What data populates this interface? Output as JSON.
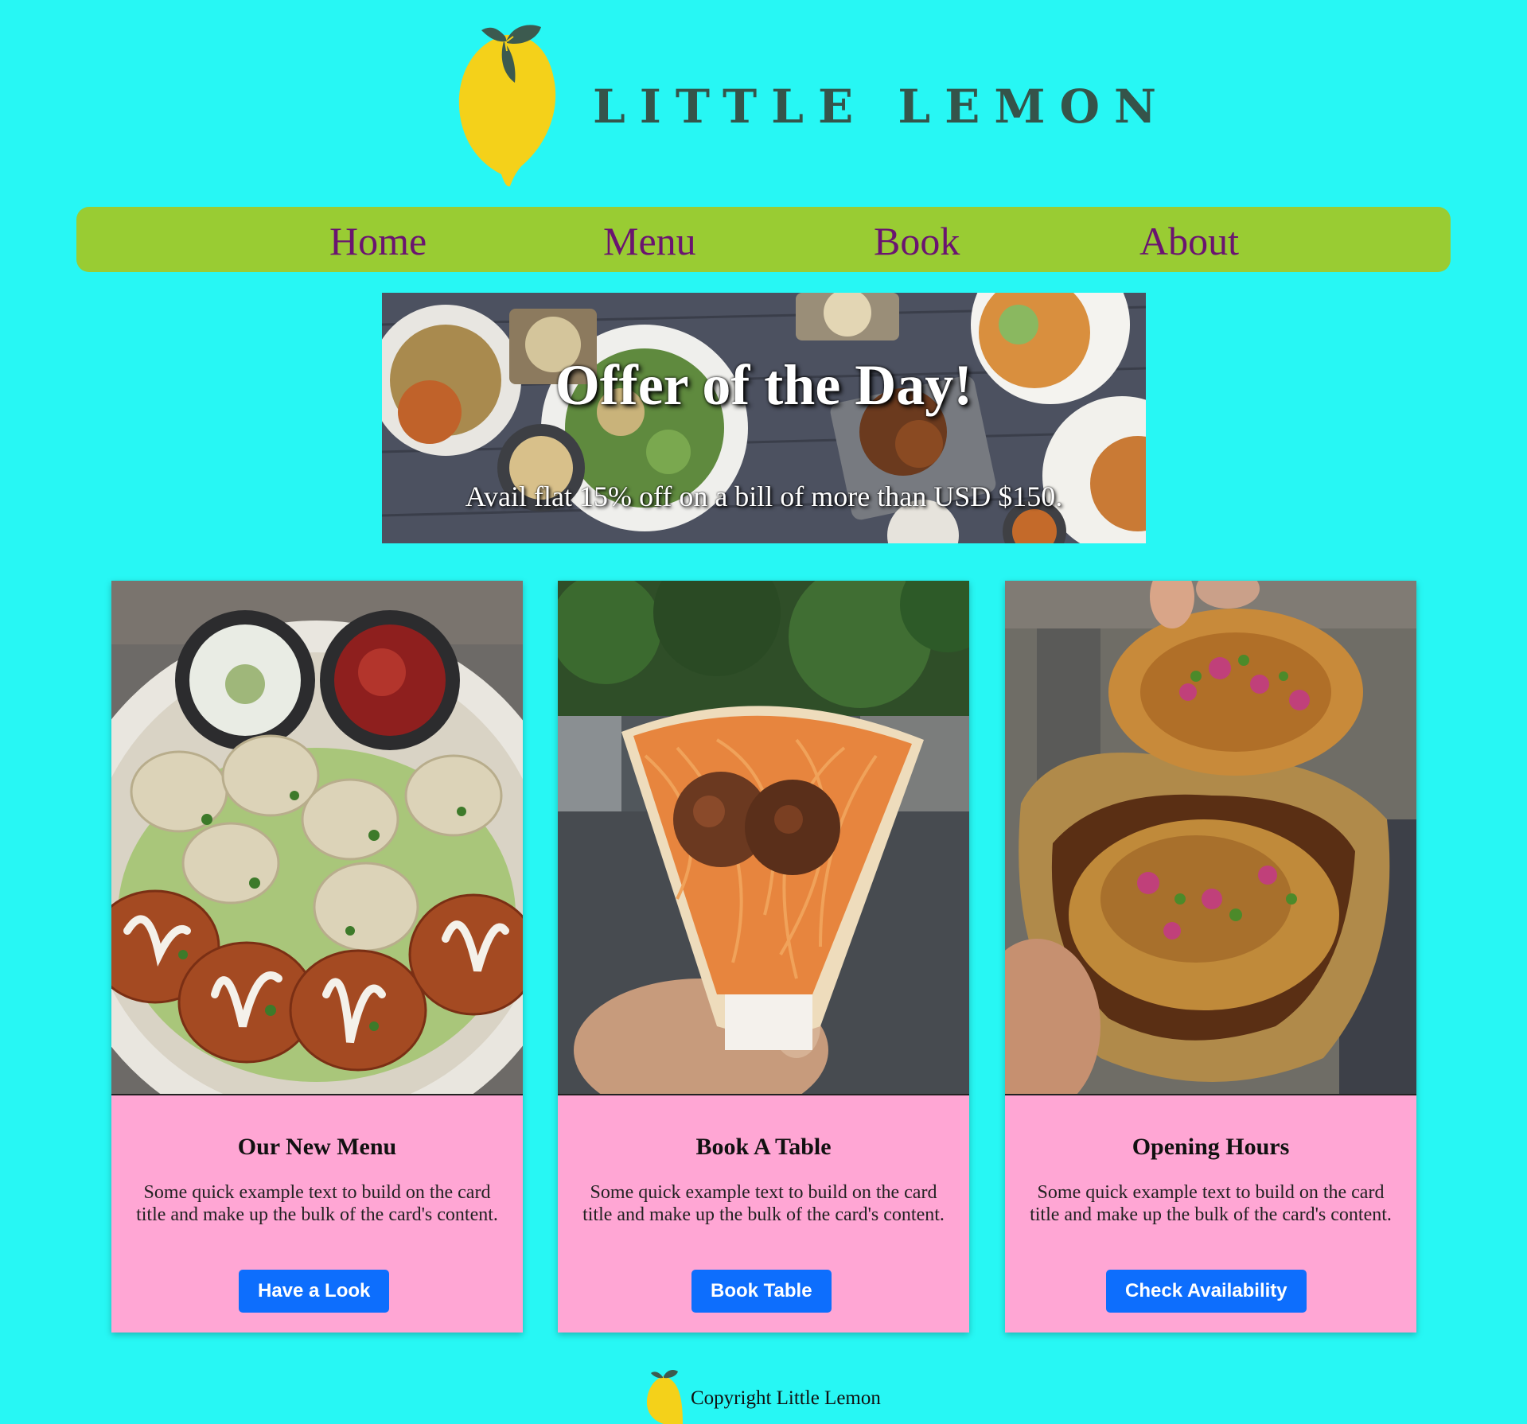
{
  "header": {
    "brand": "LITTLE LEMON",
    "logo_icon": "lemon-icon",
    "colors": {
      "background": "#27f7f4",
      "brand_text": "#35544a",
      "lemon": "#f4d11a",
      "leaf": "#3c5a4f"
    }
  },
  "nav": {
    "items": [
      {
        "label": "Home"
      },
      {
        "label": "Menu"
      },
      {
        "label": "Book"
      },
      {
        "label": "About"
      }
    ],
    "colors": {
      "bar": "#99cc33",
      "text": "#6a1470"
    }
  },
  "hero": {
    "title": "Offer of the Day!",
    "subtitle": "Avail flat 15% off on a bill of more than USD $150."
  },
  "cards": [
    {
      "title": "Our New Menu",
      "text": "Some quick example text to build on the card title and make up the bulk of the card's content.",
      "button": "Have a Look",
      "image": "momos-plate-photo"
    },
    {
      "title": "Book A Table",
      "text": "Some quick example text to build on the card title and make up the bulk of the card's content.",
      "button": "Book Table",
      "image": "noodle-wrap-photo"
    },
    {
      "title": "Opening Hours",
      "text": "Some quick example text to build on the card title and make up the bulk of the card's content.",
      "button": "Check Availability",
      "image": "chaat-bowl-photo"
    }
  ],
  "card_colors": {
    "body": "#ffa6d4",
    "button": "#0d6efd",
    "button_text": "#ffffff"
  },
  "footer": {
    "copyright": "Copyright Little Lemon",
    "logo_icon": "lemon-icon"
  }
}
